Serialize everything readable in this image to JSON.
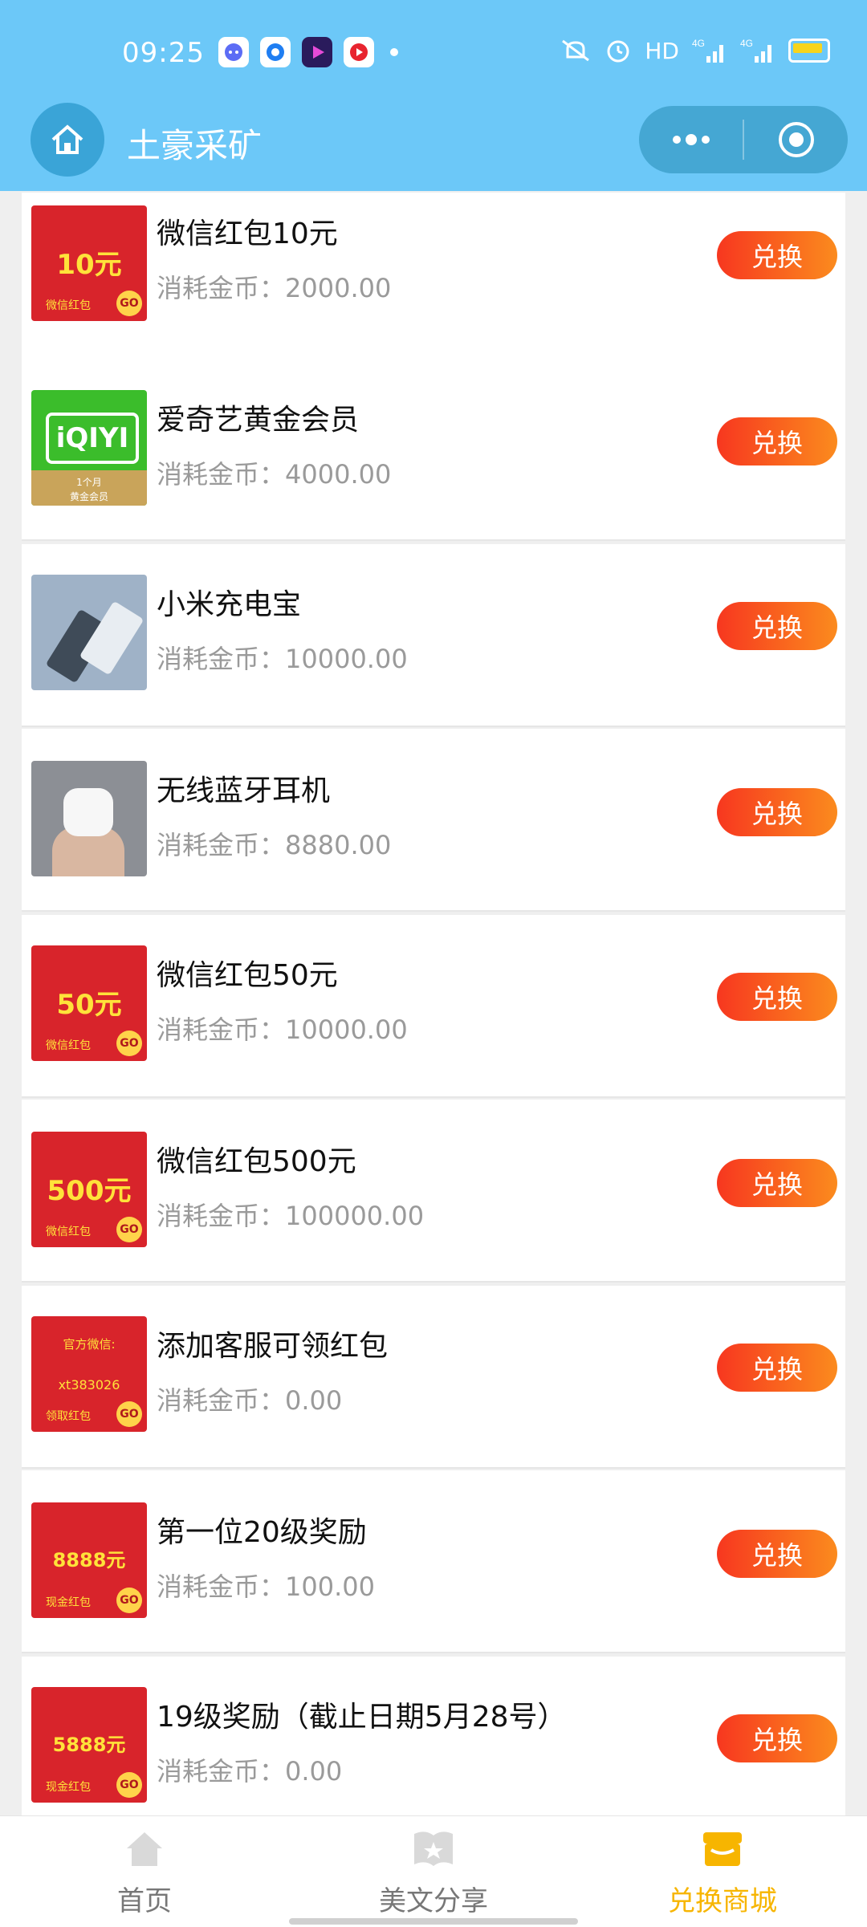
{
  "status_bar": {
    "time": "09:25",
    "hd_label": "HD",
    "signal1": "4G",
    "signal2": "4G"
  },
  "nav": {
    "title": "土豪采矿"
  },
  "items": [
    {
      "title": "微信红包10元",
      "cost": "消耗金币：2000.00",
      "button": "兑换",
      "thumb_amount": "10元",
      "thumb_sub": "微信红包",
      "thumb_go": "GO"
    },
    {
      "title": "爱奇艺黄金会员",
      "cost": "消耗金币：4000.00",
      "button": "兑换",
      "thumb_logo": "iQIYI",
      "thumb_band1": "1个月",
      "thumb_band2": "黄金会员"
    },
    {
      "title": "小米充电宝",
      "cost": "消耗金币：10000.00",
      "button": "兑换"
    },
    {
      "title": "无线蓝牙耳机",
      "cost": "消耗金币：8880.00",
      "button": "兑换"
    },
    {
      "title": "微信红包50元",
      "cost": "消耗金币：10000.00",
      "button": "兑换",
      "thumb_amount": "50元",
      "thumb_sub": "微信红包",
      "thumb_go": "GO"
    },
    {
      "title": "微信红包500元",
      "cost": "消耗金币：100000.00",
      "button": "兑换",
      "thumb_amount": "500元",
      "thumb_sub": "微信红包",
      "thumb_go": "GO"
    },
    {
      "title": "添加客服可领红包",
      "cost": "消耗金币：0.00",
      "button": "兑换",
      "thumb_line1": "官方微信:",
      "thumb_line2": "xt383026",
      "thumb_sub": "领取红包",
      "thumb_go": "GO"
    },
    {
      "title": "第一位20级奖励",
      "cost": "消耗金币：100.00",
      "button": "兑换",
      "thumb_amount": "8888元",
      "thumb_sub": "现金红包",
      "thumb_go": "GO"
    },
    {
      "title": "19级奖励（截止日期5月28号）",
      "cost": "消耗金币：0.00",
      "button": "兑换",
      "thumb_amount": "5888元",
      "thumb_sub": "现金红包",
      "thumb_go": "GO"
    }
  ],
  "tabbar": {
    "tabs": [
      {
        "label": "首页",
        "icon": "home-icon"
      },
      {
        "label": "美文分享",
        "icon": "book-icon"
      },
      {
        "label": "兑换商城",
        "icon": "shop-icon"
      }
    ],
    "active_color": "#f7b500",
    "inactive_color": "#777777"
  },
  "colors": {
    "header": "#6cc8f8",
    "button_start": "#f7371f",
    "button_end": "#fb8b1e"
  }
}
